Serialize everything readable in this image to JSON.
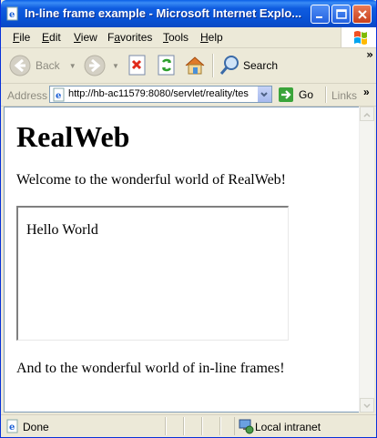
{
  "window": {
    "title": "In-line frame example - Microsoft Internet Explo...",
    "title_bar_color": "#0a5ee6"
  },
  "menu": {
    "items": [
      {
        "first": "F",
        "rest": "ile"
      },
      {
        "first": "E",
        "rest": "dit"
      },
      {
        "first": "V",
        "rest": "iew"
      },
      {
        "first": "",
        "u": "a",
        "label_pre": "F",
        "label_post": "vorites"
      },
      {
        "first": "T",
        "rest": "ools"
      },
      {
        "first": "H",
        "rest": "elp"
      }
    ]
  },
  "toolbar": {
    "back_label": "Back",
    "search_label": "Search",
    "more": "»"
  },
  "address": {
    "label": "Address",
    "url": "http://hb-ac11579:8080/servlet/reality/tes",
    "go_label": "Go",
    "links_label": "Links",
    "more": "»"
  },
  "content": {
    "heading": "RealWeb",
    "welcome": "Welcome to the wonderful world of RealWeb!",
    "iframe_text": "Hello World",
    "footer": "And to the wonderful world of in-line frames!"
  },
  "status": {
    "text": "Done",
    "zone": "Local intranet"
  },
  "icons": [
    "ie-page-icon",
    "minimize-icon",
    "maximize-icon",
    "close-icon",
    "windows-flag-icon",
    "back-arrow-icon",
    "forward-arrow-icon",
    "stop-icon",
    "refresh-icon",
    "home-icon",
    "search-icon",
    "page-icon",
    "dropdown-icon",
    "go-arrow-icon",
    "done-page-icon",
    "intranet-icon"
  ]
}
